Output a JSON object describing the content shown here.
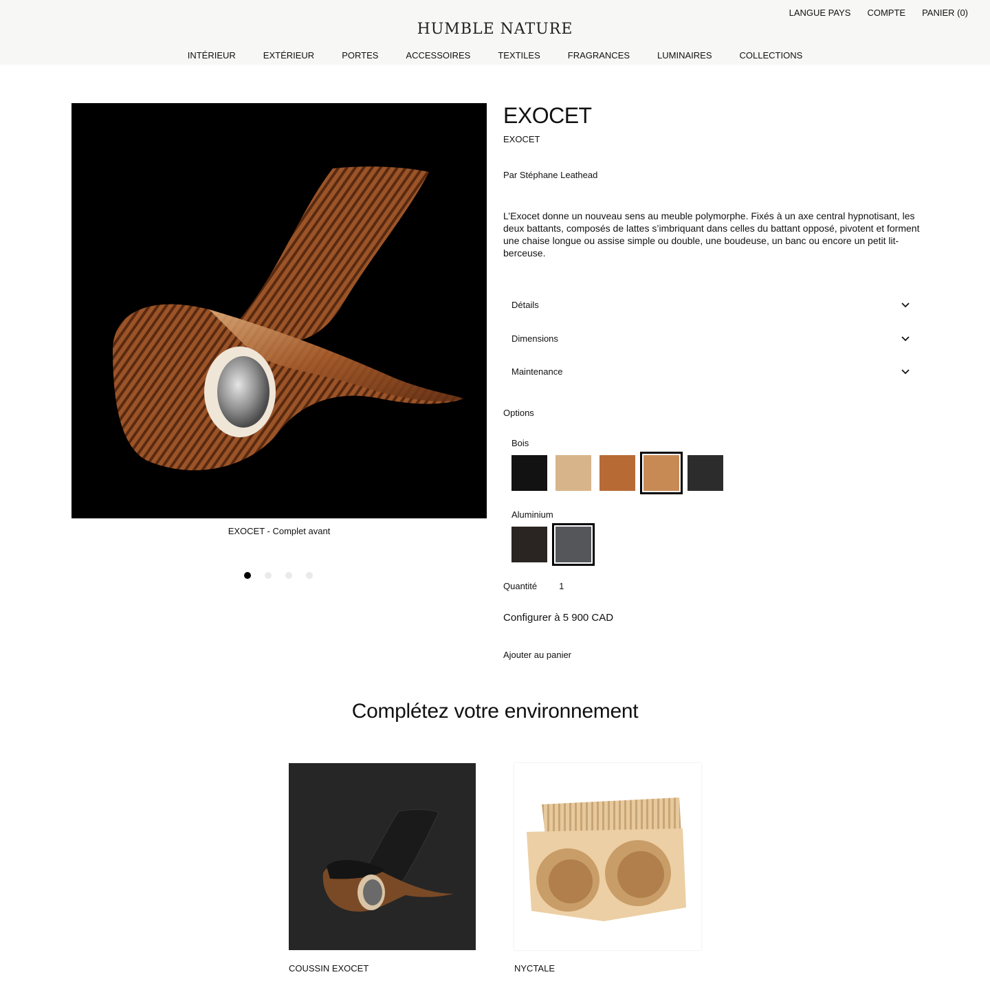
{
  "header": {
    "logo": "HUMBLE NATURE",
    "util": [
      "LANGUE PAYS",
      "COMPTE",
      "PANIER (0)"
    ],
    "nav": [
      "INTÉRIEUR",
      "EXTÉRIEUR",
      "PORTES",
      "ACCESSOIRES",
      "TEXTILES",
      "FRAGRANCES",
      "LUMINAIRES",
      "COLLECTIONS"
    ]
  },
  "gallery": {
    "caption": "EXOCET - Complet avant",
    "dots": 4,
    "active_dot": 0
  },
  "product": {
    "title": "EXOCET",
    "subtitle": "EXOCET",
    "author": "Par Stéphane Leathead",
    "description": "L’Exocet donne un nouveau sens au meuble polymorphe. Fixés à un axe central hypnotisant, les deux battants, composés de lattes s’imbriquant dans celles du battant opposé, pivotent et forment une chaise longue ou assise simple ou double, une boudeuse, un banc ou encore un petit lit-berceuse."
  },
  "accordions": [
    "Détails",
    "Dimensions",
    "Maintenance"
  ],
  "options": {
    "label": "Options",
    "bois_label": "Bois",
    "bois_swatches": [
      {
        "color": "#121212",
        "selected": false
      },
      {
        "color": "#d8b48a",
        "selected": false
      },
      {
        "color": "#b86a35",
        "selected": false
      },
      {
        "color": "#c88a55",
        "selected": true
      },
      {
        "color": "#2c2c2c",
        "selected": false
      }
    ],
    "alu_label": "Aluminium",
    "alu_swatches": [
      {
        "color": "#2a2522",
        "selected": false
      },
      {
        "color": "#55565a",
        "selected": true
      }
    ]
  },
  "quantity": {
    "label": "Quantité",
    "value": "1"
  },
  "configure_label": "Configurer à 5 900 CAD",
  "add_to_cart_label": "Ajouter au panier",
  "related": {
    "title": "Complétez votre environnement",
    "items": [
      "COUSSIN EXOCET",
      "NYCTALE"
    ]
  }
}
